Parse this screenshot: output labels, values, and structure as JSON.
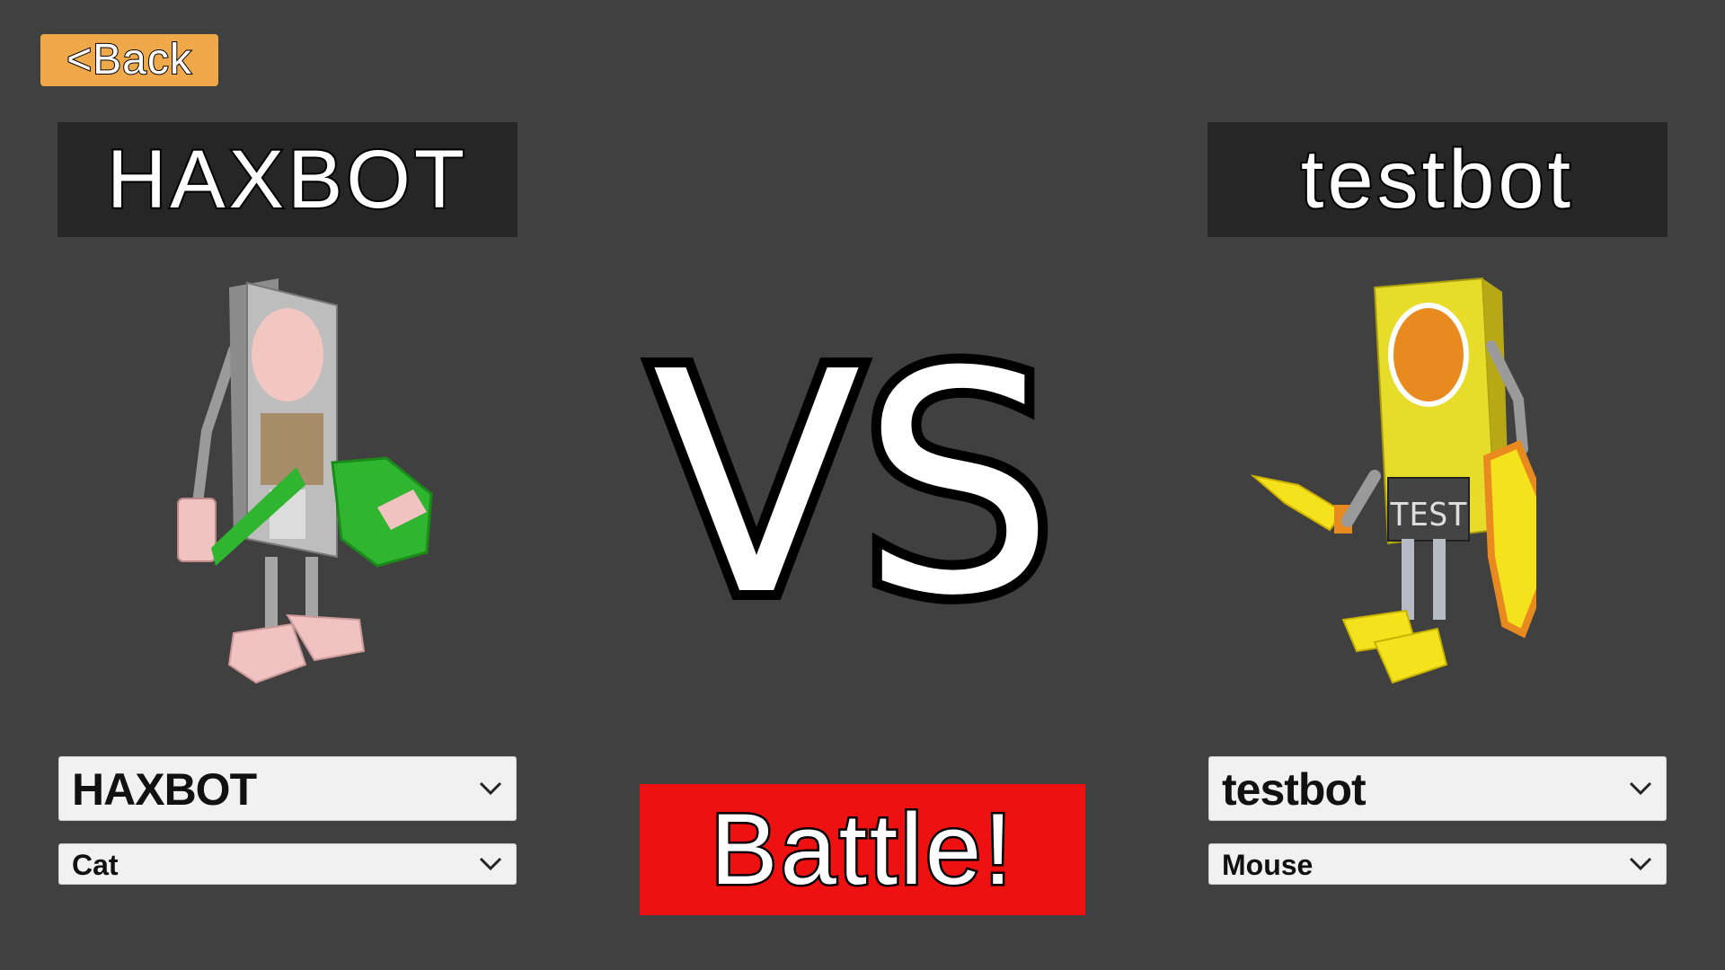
{
  "back_button": {
    "label": "<Back"
  },
  "vs_text": "VS",
  "battle_button": {
    "label": "Battle!"
  },
  "left_player": {
    "name": "HAXBOT",
    "robot_select": {
      "selected": "HAXBOT"
    },
    "controller_select": {
      "selected": "Cat"
    },
    "colors": {
      "body": "#bdbdbd",
      "face": "#f2c7c2",
      "accent": "#2fb52f",
      "feet": "#f0c2c2"
    }
  },
  "right_player": {
    "name": "testbot",
    "robot_select": {
      "selected": "testbot"
    },
    "controller_select": {
      "selected": "Mouse"
    },
    "badge_text": "TEST",
    "colors": {
      "body": "#e8dc2a",
      "face": "#e88a1f",
      "accent": "#f0a020",
      "feet": "#f4e21c"
    }
  },
  "icons": {
    "dropdown": "chevron-down-icon"
  },
  "theme": {
    "background": "#404040",
    "back_button_color": "#f0a94a",
    "battle_button_color": "#ee1111",
    "name_plate_color": "#262626"
  }
}
